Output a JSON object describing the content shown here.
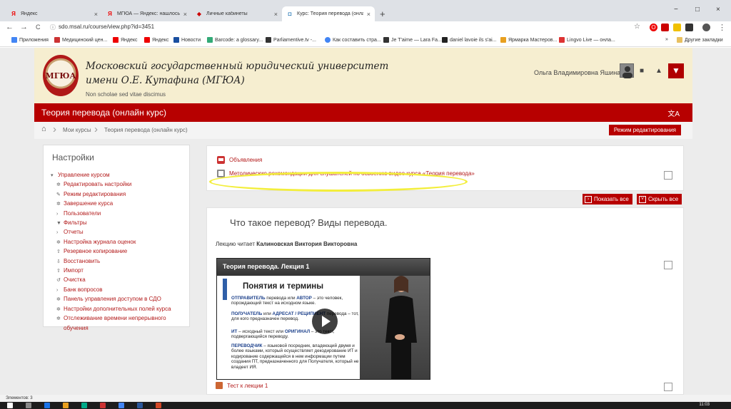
{
  "browser": {
    "tabs": [
      {
        "icon": "Я",
        "title": "Яндекс",
        "close": "×"
      },
      {
        "icon": "Я",
        "title": "МГЮА — Яндекс: нашлось 153",
        "close": "×"
      },
      {
        "icon": "◆",
        "title": "Личные кабинеты",
        "close": "×"
      },
      {
        "icon": "◘",
        "title": "Курс: Теория перевода (онлайн",
        "close": "×"
      }
    ],
    "new_tab": "+",
    "window_controls": {
      "minimize": "−",
      "maximize": "□",
      "close": "×"
    },
    "nav": {
      "back": "←",
      "forward": "→",
      "reload": "C"
    },
    "url": "sdo.msal.ru/course/view.php?id=3451",
    "star": "☆",
    "menu": "⋮",
    "bookmarks": [
      "Приложения",
      "Медицинский цен...",
      "Яндекс",
      "Яндекс",
      "Новости",
      "Barcode: a glossary...",
      "Parliamentive.tv -...",
      "Как составить стра...",
      "Je T'aime — Lara Fa...",
      "daniel lavoie ils s'ai...",
      "Ярмарка Мастеров...",
      "Lingvo Live — онла..."
    ],
    "bookmarks_more": "»",
    "other_bookmarks": "Другие закладки"
  },
  "site": {
    "logo_text": "МГЮА",
    "univ_line1": "Московский государственный юридический университет",
    "univ_line2": "имени О.Е. Кутафина (МГЮА)",
    "motto": "Non scholae sed vitae discimus",
    "user_name": "Ольга Владимировна Яшина"
  },
  "course": {
    "title": "Теория перевода (онлайн курс)",
    "breadcrumb": [
      "Мои курсы",
      "Теория перевода (онлайн курс)"
    ],
    "edit_button": "Режим редактирования"
  },
  "sidebar": {
    "title": "Настройки",
    "items": [
      {
        "icon": "▾",
        "label": "Управление курсом"
      },
      {
        "icon": "✲",
        "label": "Редактировать настройки"
      },
      {
        "icon": "✎",
        "label": "Режим редактирования"
      },
      {
        "icon": "✲",
        "label": "Завершение курса"
      },
      {
        "icon": "›",
        "label": "Пользователи"
      },
      {
        "icon": "▼",
        "label": "Фильтры"
      },
      {
        "icon": "›",
        "label": "Отчеты"
      },
      {
        "icon": "✲",
        "label": "Настройка журнала оценок"
      },
      {
        "icon": "⇧",
        "label": "Резервное копирование"
      },
      {
        "icon": "⇩",
        "label": "Восстановить"
      },
      {
        "icon": "⇧",
        "label": "Импорт"
      },
      {
        "icon": "↺",
        "label": "Очистка"
      },
      {
        "icon": "›",
        "label": "Банк вопросов"
      },
      {
        "icon": "✲",
        "label": "Панель управления доступом в СДО"
      },
      {
        "icon": "✲",
        "label": "Настройки дополнительных полей курса"
      },
      {
        "icon": "✲",
        "label": "Отслеживание времени непрерывного"
      },
      {
        "icon": "",
        "label": "обучения"
      }
    ]
  },
  "main": {
    "announcements": "Объявления",
    "guidelines": "Методические рекомендации для слушателей по освоению видео курса «Теория перевода»",
    "show_all": "Показать все",
    "hide_all": "Скрыть все",
    "section_title": "Что такое перевод? Виды перевода.",
    "lecturer_prefix": "Лекцию читает",
    "lecturer_name": "Калиновская Виктория Викторовна",
    "video": {
      "title": "Теория перевода. Лекция 1",
      "heading": "Понятия и термины",
      "p1_bold": "ОТПРАВИТЕЛЬ",
      "p1_mid": " перевода или ",
      "p1_bold2": "АВТОР",
      "p1_rest": " – это человек, порождающий текст на исходном языке.",
      "p2_bold": "ПОЛУЧАТЕЛЬ",
      "p2_mid": " или ",
      "p2_bold2": "АДРЕСАТ / РЕЦИПИЕНТ",
      "p2_rest": " перевода – тот, для кого предназначен перевод.",
      "p3_bold": "ИТ",
      "p3_mid": " – исходный текст или ",
      "p3_bold2": "ОРИГИНАЛ",
      "p3_rest": " – это текст, подвергающийся переводу.",
      "p4_bold": "ПЕРЕВОДЧИК",
      "p4_rest": " – языковой посредник, владеющий двумя и более языками, который осуществляет декодирование ИТ и кодирование содержащейся в нем информации путем создания ПТ, предназначенного для Получателя, который не владеет ИЯ."
    },
    "quiz": "Тест к лекции 1"
  },
  "status_bar": "Элементов: 3",
  "clock": "11:03",
  "colors": {
    "brand_red": "#b70000",
    "header_cream": "#f6eed0",
    "highlight_ellipse": "#f3ee3c"
  }
}
